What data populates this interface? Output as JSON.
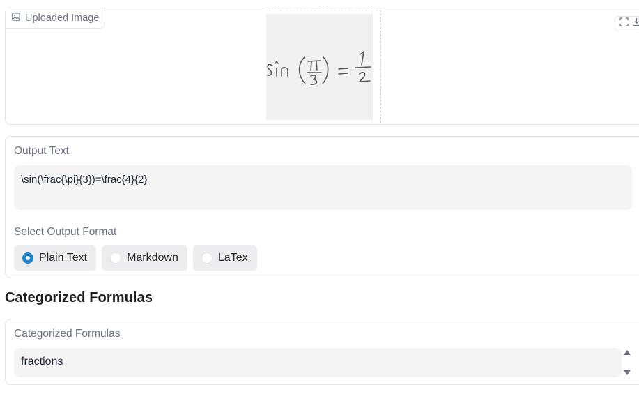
{
  "image_block": {
    "label": "Uploaded Image",
    "label_icon": "image-icon",
    "tools": [
      "fullscreen-icon",
      "download-icon"
    ],
    "handwritten_content": "sin(π/3) = 1/2"
  },
  "output": {
    "label": "Output Text",
    "value": "\\sin(\\frac{\\pi}{3})=\\frac{4}{2}",
    "format_label": "Select Output Format",
    "formats": [
      {
        "label": "Plain Text",
        "checked": true
      },
      {
        "label": "Markdown",
        "checked": false
      },
      {
        "label": "LaTex",
        "checked": false
      }
    ]
  },
  "categorized": {
    "heading": "Categorized Formulas",
    "label": "Categorized Formulas",
    "value": "fractions"
  },
  "colors": {
    "accent": "#1f87c9",
    "border": "#e4e4e7",
    "field_bg": "#f4f4f5"
  }
}
